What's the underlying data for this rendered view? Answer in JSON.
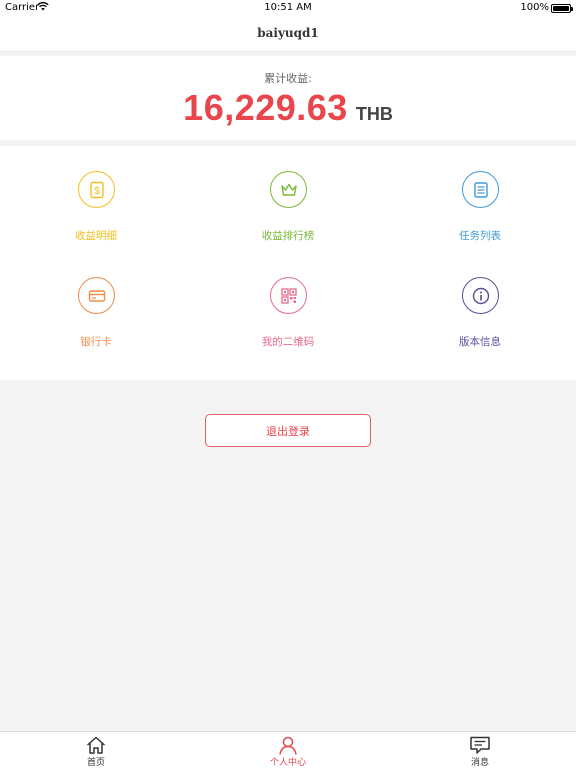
{
  "status_bar": {
    "carrier": "Carrier",
    "time": "10:51 AM",
    "battery": "100%",
    "battery_level": 1.0
  },
  "nav": {
    "title": "baiyuqd1"
  },
  "earnings": {
    "label": "累计收益:",
    "amount": "16,229.63",
    "currency": "THB",
    "amount_color": "#e8464c"
  },
  "menu": [
    {
      "label": "收益明细",
      "icon": "receipt-dollar-icon",
      "color": "#f2c020"
    },
    {
      "label": "收益排行榜",
      "icon": "crown-icon",
      "color": "#7bb83a"
    },
    {
      "label": "任务列表",
      "icon": "list-document-icon",
      "color": "#3f9ad6"
    },
    {
      "label": "银行卡",
      "icon": "bank-card-icon",
      "color": "#ee8c4a"
    },
    {
      "label": "我的二维码",
      "icon": "qr-code-icon",
      "color": "#e86a8c"
    },
    {
      "label": "版本信息",
      "icon": "info-icon",
      "color": "#5a4e9c"
    }
  ],
  "logout": {
    "label": "退出登录",
    "color": "#e8464c"
  },
  "tabs": [
    {
      "label": "首页",
      "icon": "home-icon",
      "active": false
    },
    {
      "label": "个人中心",
      "icon": "person-icon",
      "active": true
    },
    {
      "label": "消息",
      "icon": "message-icon",
      "active": false
    }
  ],
  "colors": {
    "active_tab": "#e8464c",
    "inactive_tab": "#333333",
    "background": "#f4f4f4"
  }
}
